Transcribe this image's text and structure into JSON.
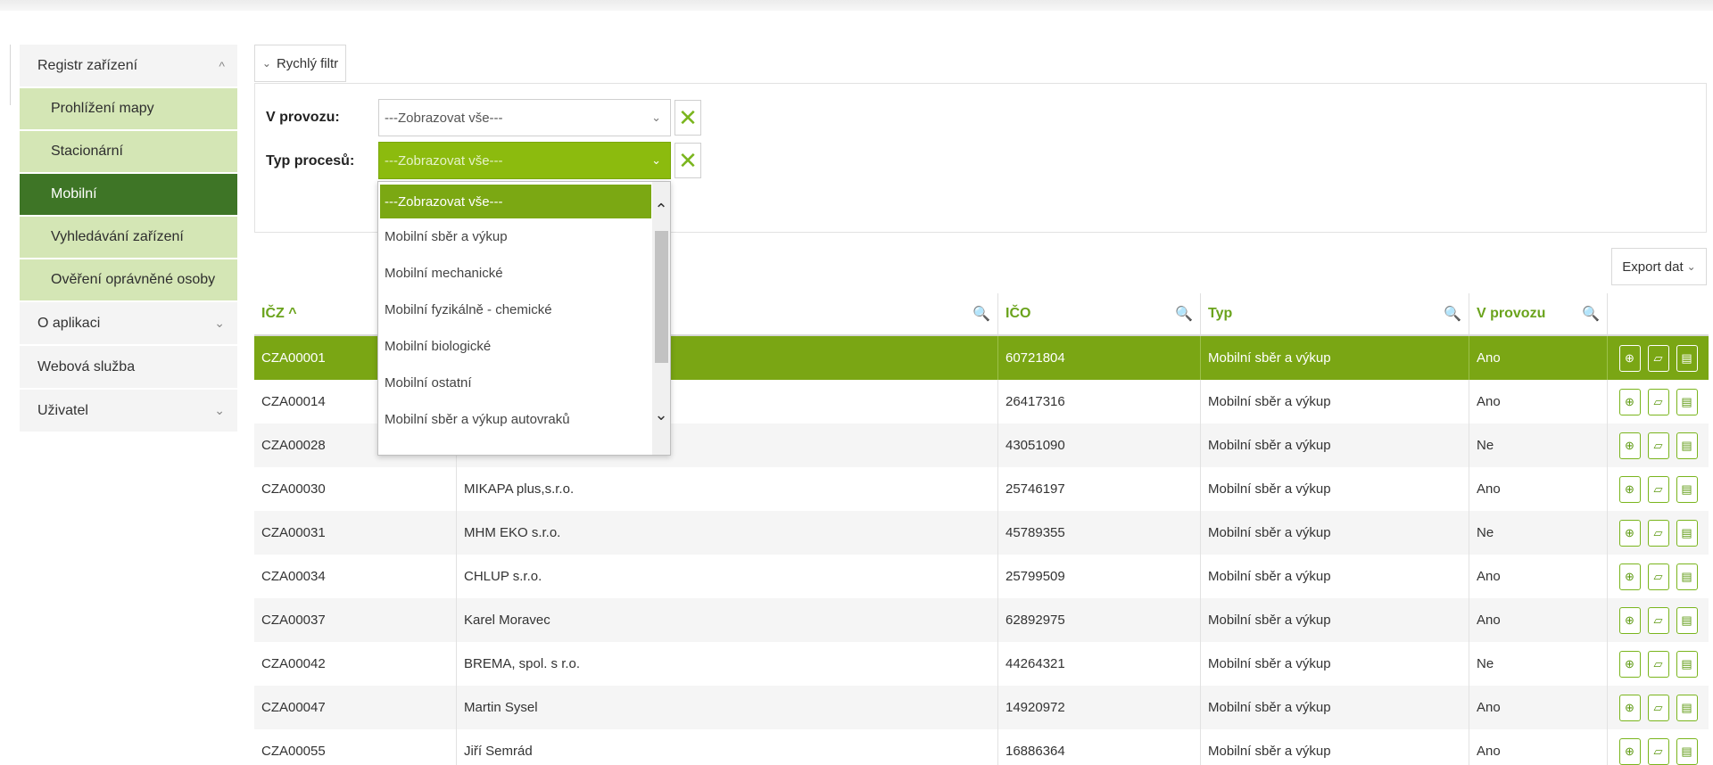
{
  "sidebar": {
    "registr": "Registr zařízení",
    "sub": [
      "Prohlížení mapy",
      "Stacionární",
      "Mobilní",
      "Vyhledávání zařízení",
      "Ověření oprávněné osoby"
    ],
    "o_aplikaci": "O aplikaci",
    "webova": "Webová služba",
    "uzivatel": "Uživatel"
  },
  "filter": {
    "toggle_label": "Rychlý filtr",
    "v_provozu_label": "V provozu:",
    "v_provozu_value": "---Zobrazovat vše---",
    "typ_label": "Typ procesů:",
    "typ_value": "---Zobrazovat vše---"
  },
  "dropdown": {
    "options": [
      "---Zobrazovat vše---",
      "Mobilní sběr a výkup",
      "Mobilní mechanické",
      "Mobilní fyzikálně - chemické",
      "Mobilní biologické",
      "Mobilní ostatní",
      "Mobilní sběr a výkup autovraků"
    ]
  },
  "export_label": "Export dat",
  "table": {
    "headers": [
      "IČZ ^",
      "",
      "IČO",
      "Typ",
      "V provozu"
    ],
    "rows": [
      [
        "CZA00001",
        "",
        "60721804",
        "Mobilní sběr a výkup",
        "Ano"
      ],
      [
        "CZA00014",
        "",
        "26417316",
        "Mobilní sběr a výkup",
        "Ano"
      ],
      [
        "CZA00028",
        "",
        "43051090",
        "Mobilní sběr a výkup",
        "Ne"
      ],
      [
        "CZA00030",
        "MIKAPA plus,s.r.o.",
        "25746197",
        "Mobilní sběr a výkup",
        "Ano"
      ],
      [
        "CZA00031",
        "MHM EKO s.r.o.",
        "45789355",
        "Mobilní sběr a výkup",
        "Ne"
      ],
      [
        "CZA00034",
        "CHLUP s.r.o.",
        "25799509",
        "Mobilní sběr a výkup",
        "Ano"
      ],
      [
        "CZA00037",
        "Karel Moravec",
        "62892975",
        "Mobilní sběr a výkup",
        "Ano"
      ],
      [
        "CZA00042",
        "BREMA, spol. s r.o.",
        "44264321",
        "Mobilní sběr a výkup",
        "Ne"
      ],
      [
        "CZA00047",
        "Martin Sysel",
        "14920972",
        "Mobilní sběr a výkup",
        "Ano"
      ],
      [
        "CZA00055",
        "Jiří Semrád",
        "16886364",
        "Mobilní sběr a výkup",
        "Ano"
      ]
    ]
  },
  "colors": {
    "accent": "#7aa614",
    "active_nav": "#3e7526",
    "sub_nav": "#d4e6b5"
  }
}
